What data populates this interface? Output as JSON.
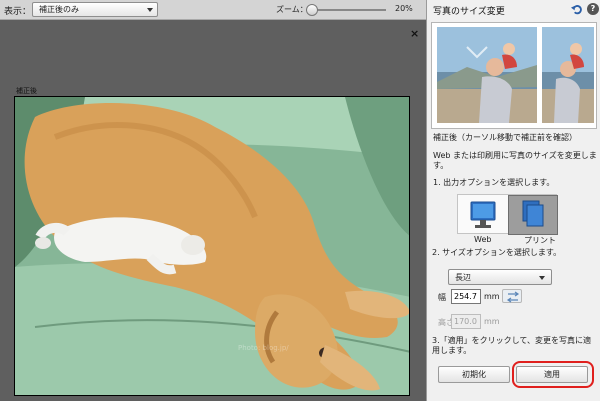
{
  "toolbar": {
    "view_label": "表示：",
    "view_value": "補正後のみ",
    "zoom_label": "ズーム：",
    "zoom_value": "20%",
    "zoom_level_fraction": 0.0
  },
  "preview": {
    "close_symbol": "×",
    "after_label": "補正後",
    "watermark": "Photo: blog.jp/"
  },
  "panel": {
    "title": "写真のサイズ変更",
    "help_symbol": "?",
    "thumbs_caption": "補正後（カーソル移動で補正前を確認）",
    "info": "Web または印刷用に写真のサイズを変更します。",
    "step1": "1. 出力オプションを選択します。",
    "output_web": "Web",
    "output_print": "プリント",
    "step2": "2. サイズオプションを選択します。",
    "size_option": "長辺",
    "width_label": "幅",
    "width_value": "254.7",
    "width_unit": "mm",
    "height_label": "高さ",
    "height_value": "170.0",
    "height_unit": "mm",
    "step3": "3.「適用」をクリックして、変更を写真に適用します。",
    "reset_label": "初期化",
    "apply_label": "適用"
  },
  "colors": {
    "accent": "#e0201e",
    "selected_output": "#9d9d9d",
    "sofa": "#8fbf9f",
    "dog": "#d9a15a"
  }
}
